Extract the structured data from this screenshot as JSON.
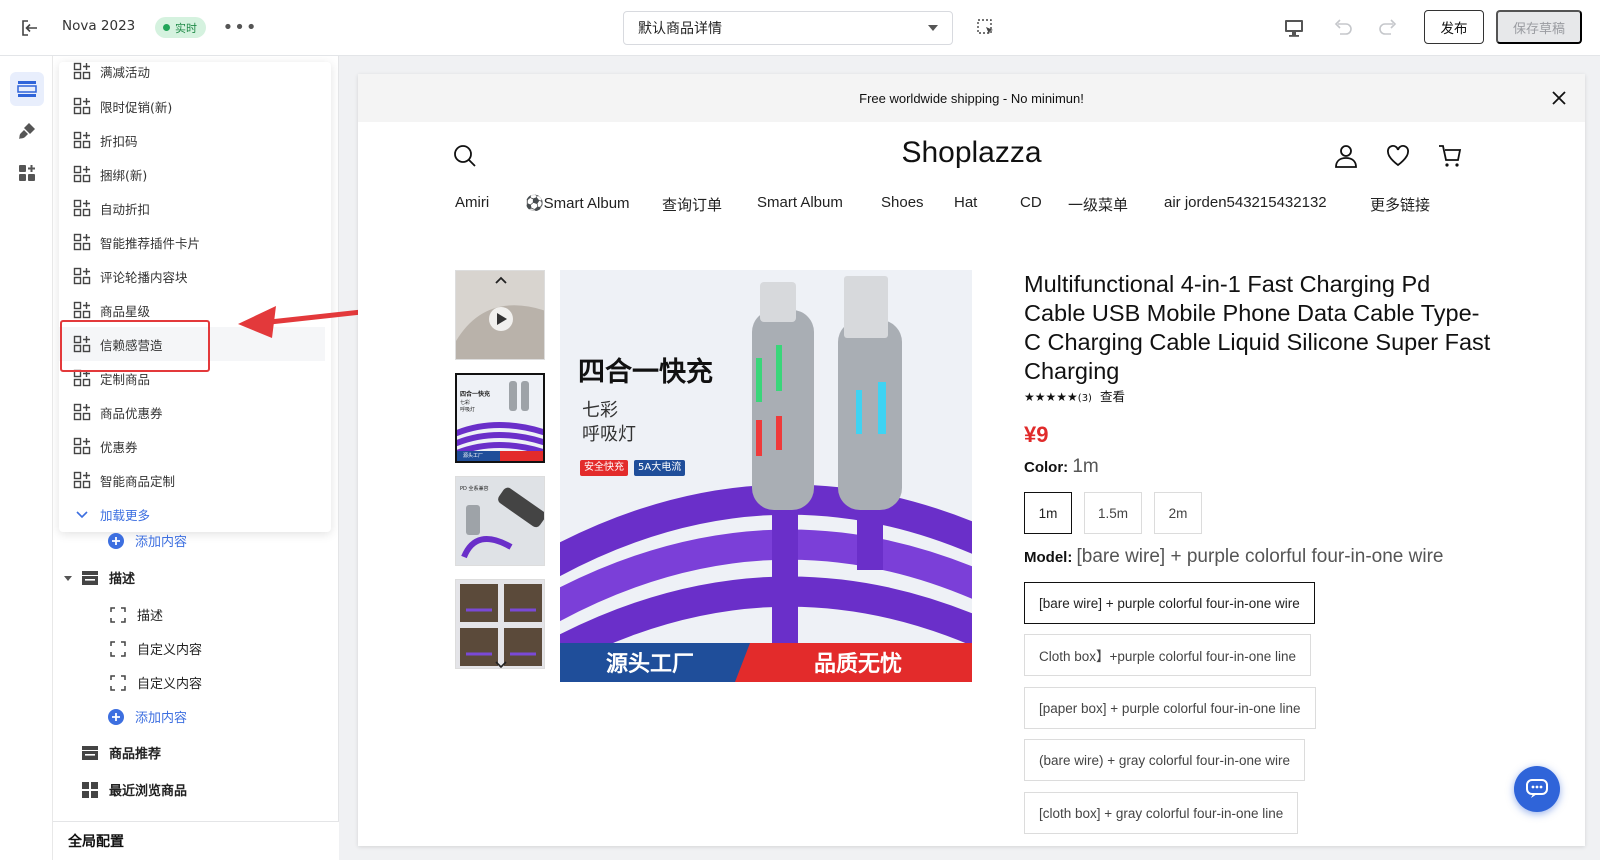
{
  "topbar": {
    "store_name": "Nova 2023",
    "live_badge": "实时",
    "more": "•••",
    "template_select": "默认商品详情",
    "publish_label": "发布",
    "save_draft_label": "保存草稿"
  },
  "sidebar_dropdown": {
    "items": [
      {
        "label": "满减活动"
      },
      {
        "label": "限时促销(新)"
      },
      {
        "label": "折扣码"
      },
      {
        "label": "捆绑(新)"
      },
      {
        "label": "自动折扣"
      },
      {
        "label": "智能推荐插件卡片"
      },
      {
        "label": "评论轮播内容块"
      },
      {
        "label": "商品星级"
      },
      {
        "label": "信赖感营造"
      },
      {
        "label": "定制商品"
      },
      {
        "label": "商品优惠券"
      },
      {
        "label": "优惠券"
      },
      {
        "label": "智能商品定制"
      }
    ],
    "load_more": "加载更多"
  },
  "sidebar_tree": {
    "add_content_1": "添加内容",
    "section_description": "描述",
    "block_description": "描述",
    "block_custom_1": "自定义内容",
    "block_custom_2": "自定义内容",
    "add_content_2": "添加内容",
    "section_recommend": "商品推荐",
    "section_recent": "最近浏览商品"
  },
  "global_config": "全局配置",
  "store": {
    "shipping_banner": "Free worldwide shipping - No minimun!",
    "logo": "Shoplazza",
    "nav": [
      "Amiri",
      "⚽Smart Album",
      "查询订单",
      "Smart Album",
      "Shoes",
      "Hat",
      "CD",
      "一级菜单",
      "air jorden543215432132",
      "更多链接"
    ]
  },
  "product": {
    "title": "Multifunctional 4-in-1 Fast Charging Pd Cable USB Mobile Phone Data Cable Type-C Charging Cable Liquid Silicone Super Fast Charging",
    "stars": "★★★★★",
    "review_count": "(3)",
    "view_label": "查看",
    "price": "¥9",
    "color_label": "Color:",
    "color_value": "1m",
    "colors": [
      "1m",
      "1.5m",
      "2m"
    ],
    "model_label": "Model:",
    "model_value": "[bare wire] + purple colorful four-in-one wire",
    "models": [
      "[bare wire] + purple colorful four-in-one wire",
      "Cloth box】+purple colorful four-in-one line",
      "[paper box] + purple colorful four-in-one line",
      "(bare wire) + gray colorful four-in-one wire",
      "[cloth box] + gray colorful four-in-one line"
    ],
    "image": {
      "headline": "四合一快充",
      "sub1": "七彩",
      "sub2": "呼吸灯",
      "tag_red": "安全快充",
      "tag_blue": "5A大电流",
      "footer_left": "源头工厂",
      "footer_right": "品质无忧"
    },
    "thumb_small": {
      "t1": "四合一快充",
      "t2": "七彩",
      "t3": "呼吸灯",
      "t4": "源头工厂",
      "t5": "PD 全系兼容"
    }
  },
  "colors": {
    "accent": "#3d6fe0",
    "price": "#e02b2b",
    "live": "#22a559",
    "highlight": "#e3393b",
    "cable": "#6a2fc9"
  }
}
